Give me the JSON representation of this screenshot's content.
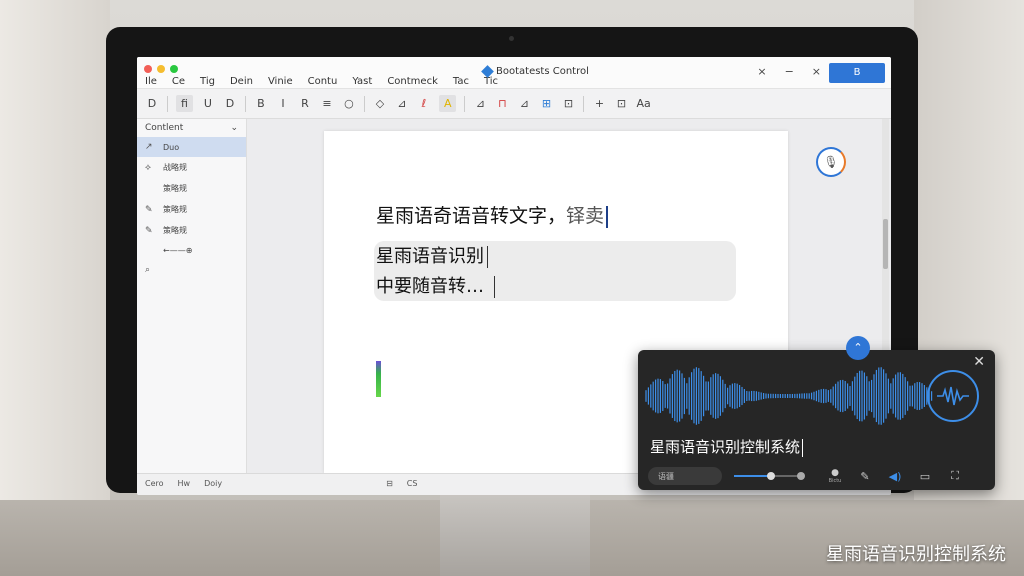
{
  "window": {
    "title": "Bootatests Control",
    "menu": [
      "Ile",
      "Ce",
      "Tig",
      "Dein",
      "Vinie",
      "Contu",
      "Yast",
      "Contmeck",
      "Tac",
      "Tic"
    ],
    "primary_button": "B",
    "controls": [
      "×",
      "−",
      "×"
    ]
  },
  "toolbar": {
    "items": [
      "D",
      "fi",
      "U",
      "D",
      "B",
      "I",
      "R",
      "≡",
      "○",
      "◇",
      "⊿",
      "ℓ",
      "A",
      "⊿",
      "⊓",
      "⊿",
      "⊞",
      "⊡",
      "+",
      "⊡",
      "Aa"
    ]
  },
  "sidebar": {
    "header": "Contlent",
    "items": [
      {
        "icon": "↗",
        "label": "Duo"
      },
      {
        "icon": "⟡",
        "label": "战略规"
      },
      {
        "icon": "",
        "label": "策略规"
      },
      {
        "icon": "✎",
        "label": "策略规"
      },
      {
        "icon": "✎",
        "label": "策略规"
      },
      {
        "icon": "",
        "label": "←——⊕"
      },
      {
        "icon": "⌕",
        "label": ""
      }
    ]
  },
  "document": {
    "line1": "星雨语奇语音转文字，",
    "line1_tail": "铎卖",
    "line2": "星雨语音识别",
    "line3": "中要随音转…"
  },
  "statusbar": {
    "items": [
      "Cero",
      "Hw",
      "Doiy",
      "⊟",
      "CS"
    ]
  },
  "voice_panel": {
    "text": "星雨语音识别控制系统",
    "language": "语疆",
    "mic_label": "Bictu",
    "volume": 0.55,
    "accent_color": "#3d8ee8"
  },
  "caption": "星雨语音识别控制系统"
}
